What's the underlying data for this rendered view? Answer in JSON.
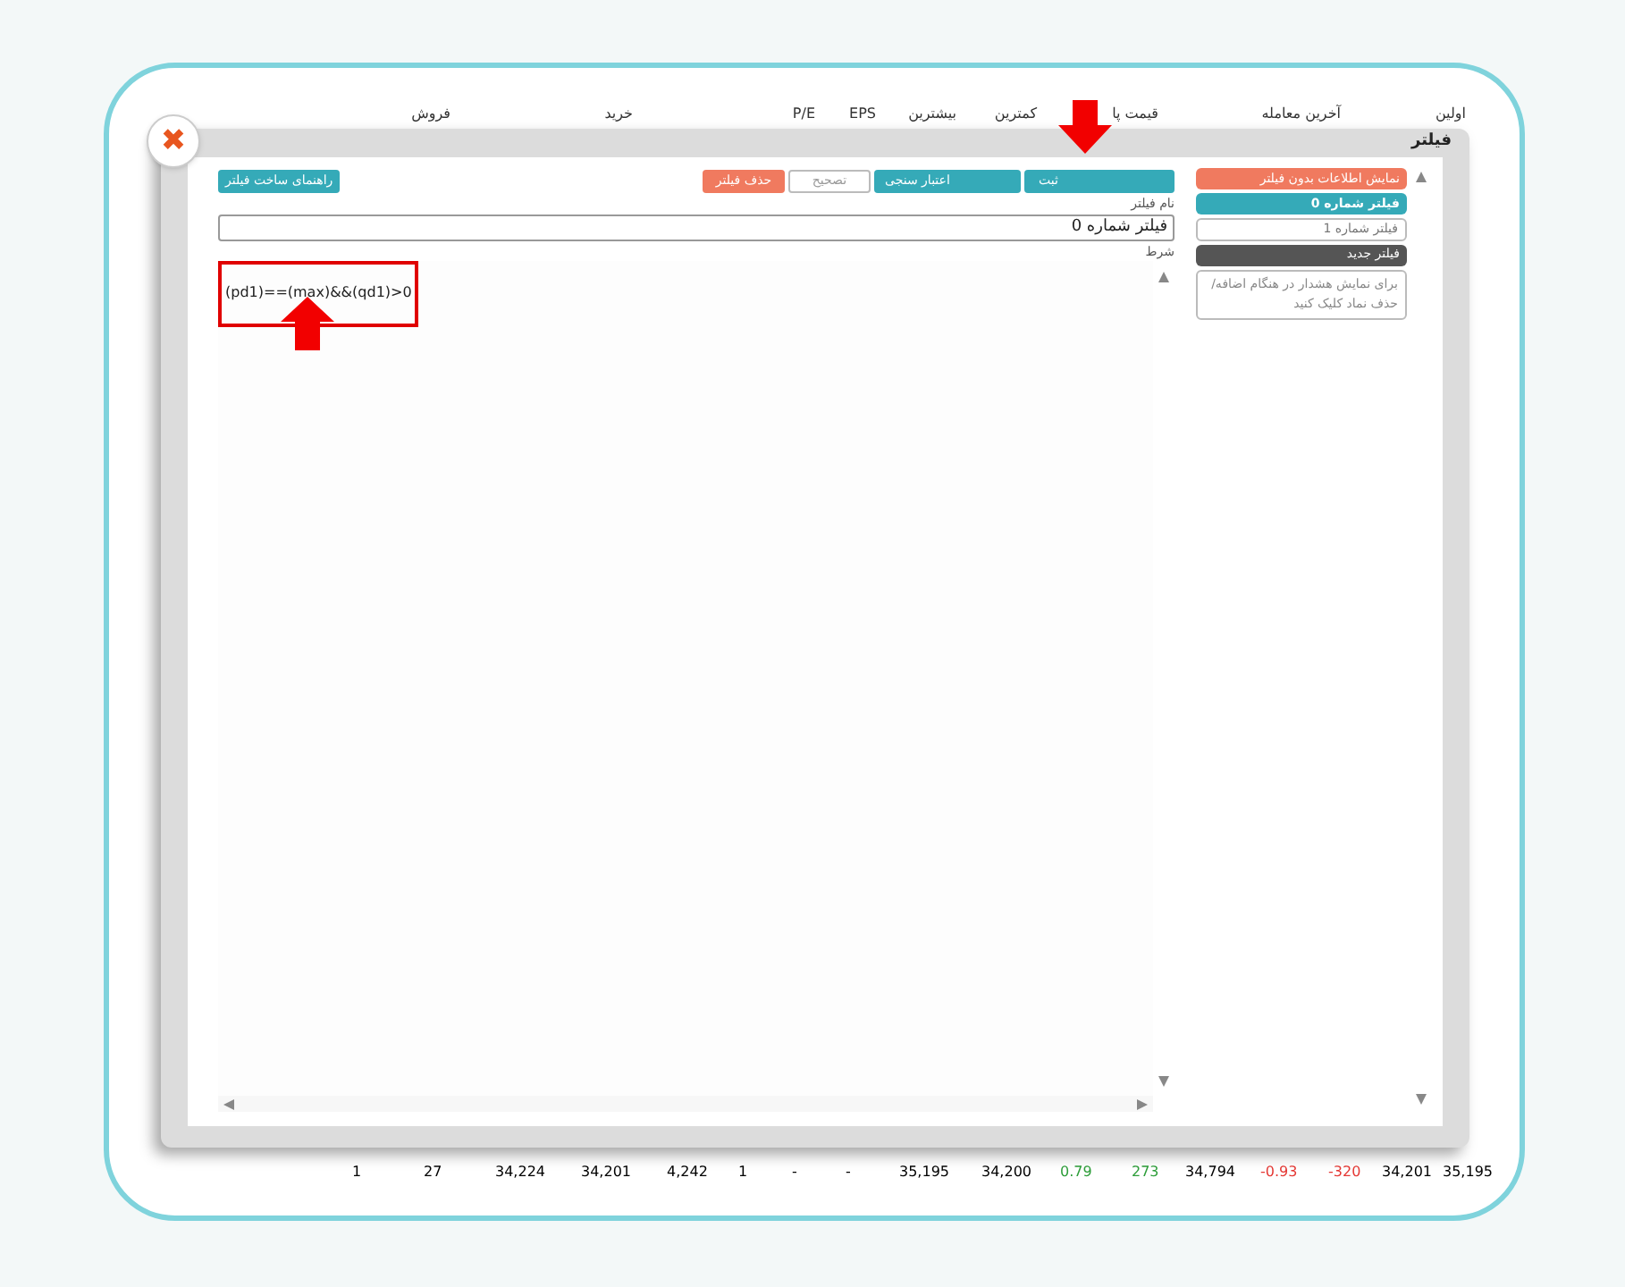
{
  "table_header": {
    "labels": [
      "اولین",
      "آخرین معامله",
      "قیمت پا",
      "کمترین",
      "بیشترین",
      "EPS",
      "P/E",
      "خرید",
      "فروش"
    ]
  },
  "table_row": {
    "cells": [
      {
        "text": "35,195",
        "color": "#000000"
      },
      {
        "text": "34,201",
        "color": "#000000"
      },
      {
        "text": "-320",
        "color": "#e53935"
      },
      {
        "text": "-0.93",
        "color": "#e53935"
      },
      {
        "text": "34,794",
        "color": "#000000"
      },
      {
        "text": "273",
        "color": "#2e9e3a"
      },
      {
        "text": "0.79",
        "color": "#2e9e3a"
      },
      {
        "text": "34,200",
        "color": "#000000"
      },
      {
        "text": "35,195",
        "color": "#000000"
      },
      {
        "text": "-",
        "color": "#000000"
      },
      {
        "text": "-",
        "color": "#000000"
      },
      {
        "text": "1",
        "color": "#000000"
      },
      {
        "text": "4,242",
        "color": "#000000"
      },
      {
        "text": "34,201",
        "color": "#000000"
      },
      {
        "text": "34,224",
        "color": "#000000"
      },
      {
        "text": "27",
        "color": "#000000"
      },
      {
        "text": "1",
        "color": "#000000"
      }
    ]
  },
  "dialog": {
    "title": "فیلتر",
    "close": "✖",
    "toolbar": [
      {
        "label": "ثبت",
        "kind": "primary"
      },
      {
        "label": "اعتبار سنجی",
        "kind": "secondary"
      },
      {
        "label": "تصحیح",
        "kind": "disabled"
      },
      {
        "label": "حذف فیلتر",
        "kind": "danger"
      }
    ],
    "help_button": "راهنمای ساخت فیلتر",
    "name_label": "نام فیلتر",
    "name_value": "فیلتر شماره 0",
    "condition_label": "شرط",
    "condition_value": "(pd1)==(max)&&(qd1)>0",
    "filters": [
      {
        "label": "نمایش اطلاعات بدون فیلتر",
        "kind": "all"
      },
      {
        "label": "فیلتر شماره 0",
        "kind": "filter",
        "selected": true
      },
      {
        "label": "فیلتر شماره 1",
        "kind": "filter",
        "selected": false
      },
      {
        "label": "فیلتر جدید",
        "kind": "new"
      },
      {
        "label": "برای نمایش هشدار در هنگام اضافه/حذف نماد کلیک کنید",
        "kind": "hint"
      }
    ]
  }
}
